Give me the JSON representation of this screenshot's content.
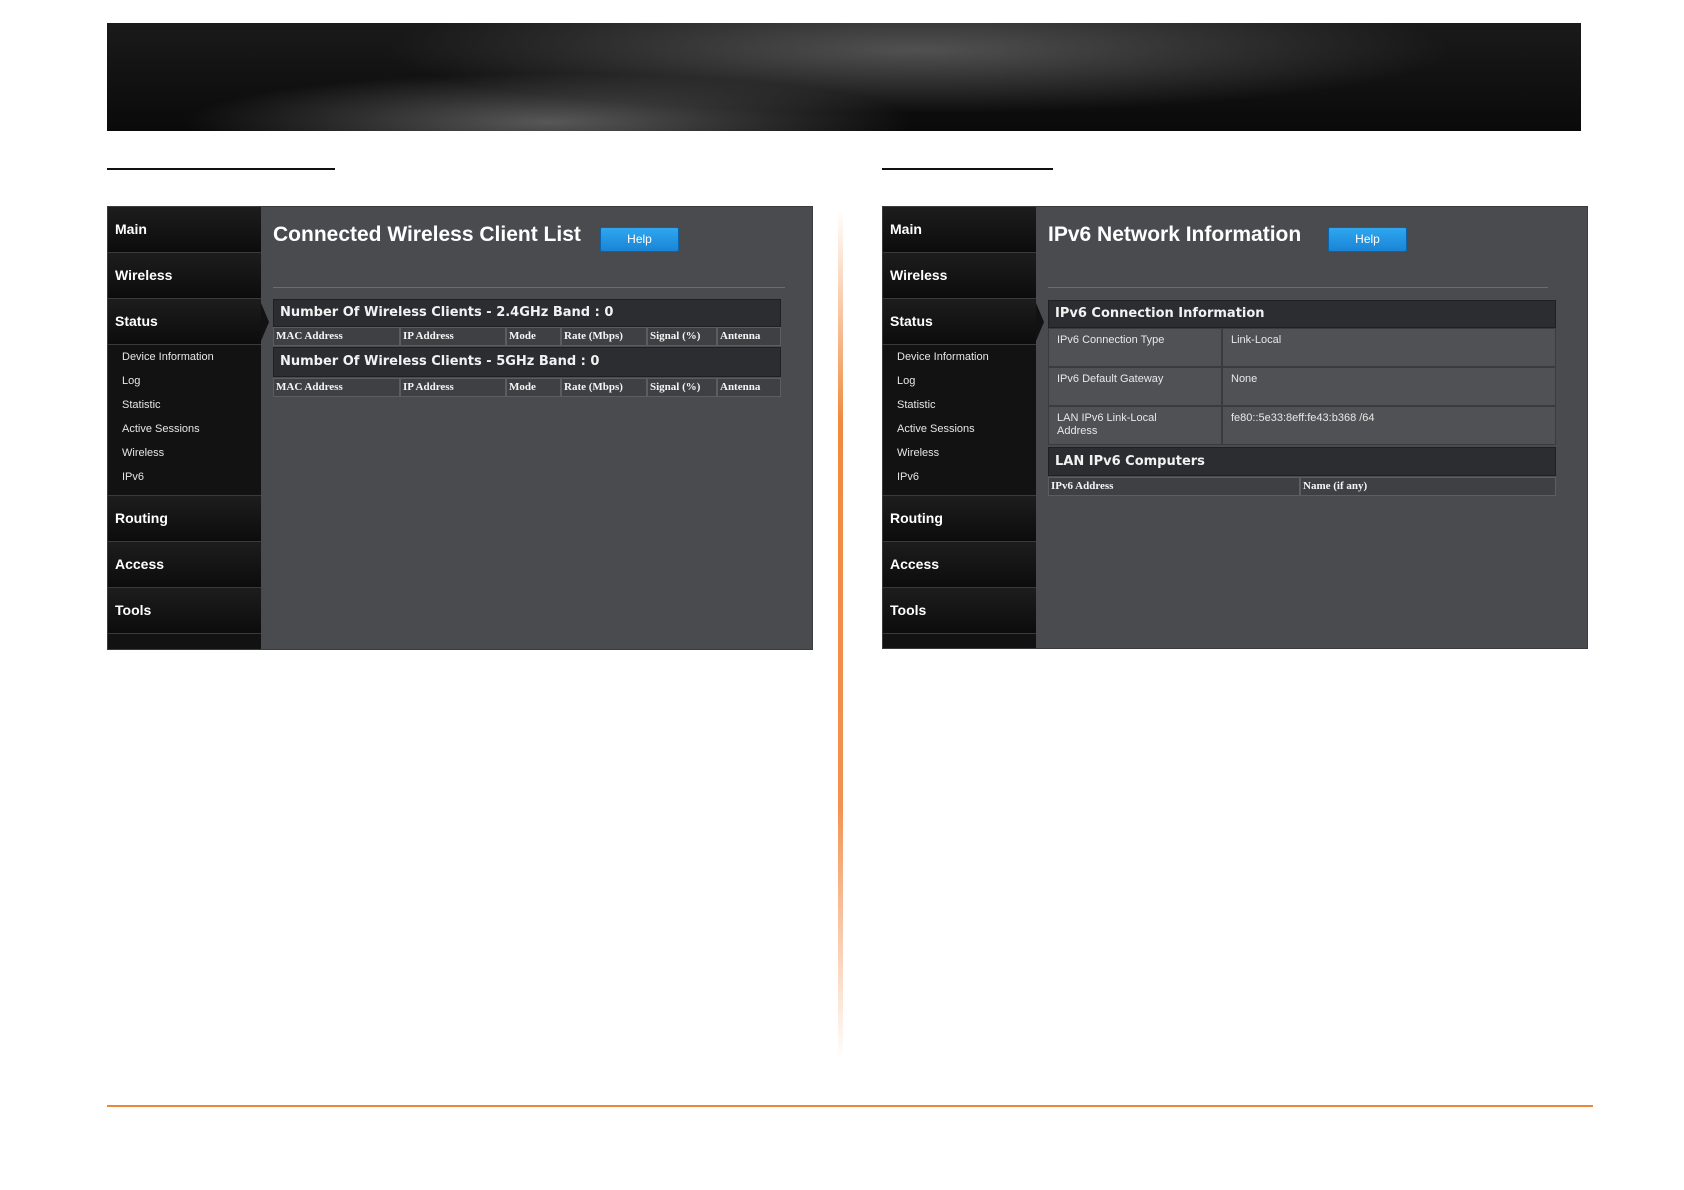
{
  "left_panel": {
    "nav": {
      "main": "Main",
      "wireless": "Wireless",
      "status": "Status",
      "sub_items": [
        "Device Information",
        "Log",
        "Statistic",
        "Active Sessions",
        "Wireless",
        "IPv6"
      ],
      "routing": "Routing",
      "access": "Access",
      "tools": "Tools"
    },
    "title": "Connected Wireless Client List",
    "help_label": "Help",
    "band_24_header": "Number Of Wireless Clients - 2.4GHz Band : 0",
    "band_5_header": "Number Of Wireless Clients - 5GHz Band : 0",
    "columns": [
      "MAC Address",
      "IP Address",
      "Mode",
      "Rate (Mbps)",
      "Signal (%)",
      "Antenna"
    ]
  },
  "right_panel": {
    "nav": {
      "main": "Main",
      "wireless": "Wireless",
      "status": "Status",
      "sub_items": [
        "Device Information",
        "Log",
        "Statistic",
        "Active Sessions",
        "Wireless",
        "IPv6"
      ],
      "routing": "Routing",
      "access": "Access",
      "tools": "Tools"
    },
    "title": "IPv6 Network Information",
    "help_label": "Help",
    "connection_header": "IPv6 Connection Information",
    "rows": [
      {
        "label": "IPv6 Connection Type",
        "value": "Link-Local"
      },
      {
        "label": "IPv6 Default Gateway",
        "value": "None"
      },
      {
        "label": "LAN IPv6 Link-Local Address",
        "value": "fe80::5e33:8eff:fe43:b368 /64"
      }
    ],
    "computers_header": "LAN IPv6 Computers",
    "computer_columns": [
      "IPv6 Address",
      "Name (if any)"
    ]
  },
  "colors": {
    "accent_orange": "#e8893a",
    "help_blue": "#1a84d6",
    "panel_bg": "#4a4b4f",
    "sidebar_bg": "#121212"
  }
}
